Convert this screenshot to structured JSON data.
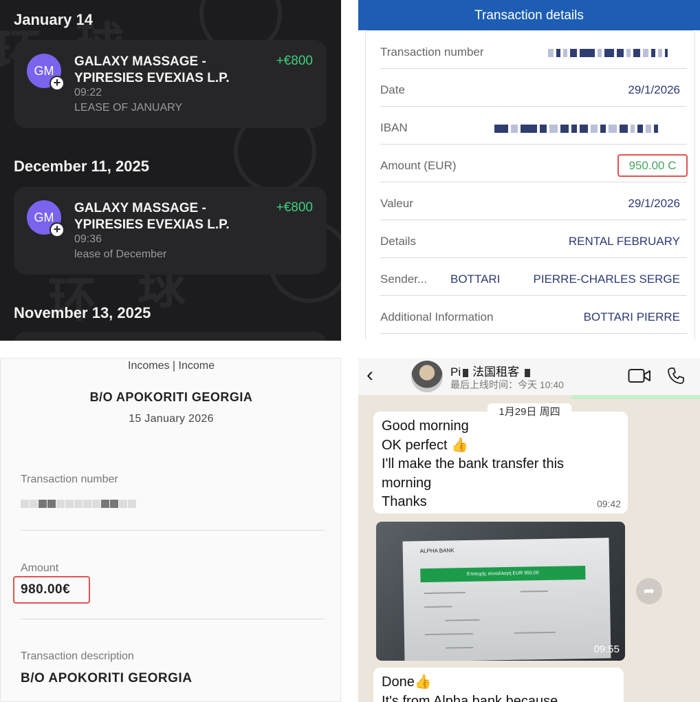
{
  "panel1": {
    "groups": [
      {
        "date": "January 14",
        "name": "GALAXY MASSAGE - YPIRESIES EVEXIAS L.P.",
        "initials": "GM",
        "amount": "+€800",
        "time": "09:22",
        "description": "LEASE OF JANUARY"
      },
      {
        "date": "December 11, 2025",
        "name": "GALAXY MASSAGE - YPIRESIES EVEXIAS L.P.",
        "initials": "GM",
        "amount": "+€800",
        "time": "09:36",
        "description": "lease of December"
      },
      {
        "date": "November 13, 2025"
      }
    ],
    "colors": {
      "background": "#1c1c1e",
      "card": "#262628",
      "amount": "#3ecf7c",
      "avatar": "#7b63ee"
    },
    "watermark": "GLOBEVISA"
  },
  "panel2": {
    "header": "Transaction details",
    "rows": [
      {
        "label": "Transaction number",
        "value": ""
      },
      {
        "label": "Date",
        "value": "29/1/2026"
      },
      {
        "label": "IBAN",
        "value": ""
      },
      {
        "label": "Amount (EUR)",
        "value": "950.00 C"
      },
      {
        "label": "Valeur",
        "value": "29/1/2026"
      },
      {
        "label": "Details",
        "value": "RENTAL FEBRUARY"
      },
      {
        "label": "Sender...",
        "value": "PIERRE-CHARLES SERGE",
        "value2": "BOTTARI"
      },
      {
        "label": "Additional Information",
        "value": "BOTTARI PIERRE"
      }
    ],
    "colors": {
      "header": "#1d5eb4",
      "value": "#2d3a75",
      "amount": "#49a360",
      "highlight": "#e0544f"
    }
  },
  "panel3": {
    "breadcrumb": "Incomes | Income",
    "title": "B/O APOKORITI GEORGIA",
    "date": "15 January 2026",
    "transaction_number_label": "Transaction number",
    "amount_label": "Amount",
    "amount": "980.00€",
    "description_label": "Transaction description",
    "description": "B/O APOKORITI GEORGIA"
  },
  "panel4": {
    "contact_name": "Pi",
    "contact_suffix": "法国租客",
    "status": "最后上线时间：今天 10:40",
    "date_chip": "1月29日 周四",
    "messages": [
      {
        "lines": [
          "Good morning",
          "OK perfect 👍",
          "I'll make the bank transfer this",
          "morning",
          "Thanks"
        ],
        "time": "09:42"
      },
      {
        "type": "image",
        "time": "09:55",
        "doc_bank": "ALPHA BANK",
        "doc_title": "Επιτυχής συναλλαγή EUR 950,00"
      },
      {
        "lines": [
          "Done👍",
          "It's from  Alpha bank because"
        ]
      }
    ],
    "icons": [
      "back-icon",
      "video-call-icon",
      "phone-icon",
      "share-icon"
    ]
  }
}
